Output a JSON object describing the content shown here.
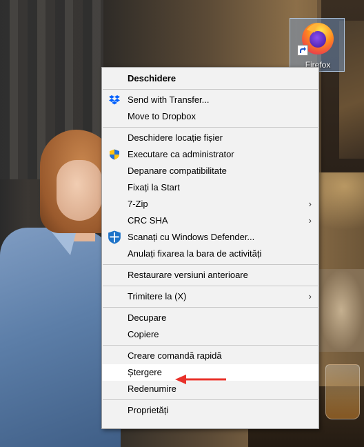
{
  "desktop": {
    "icon_label": "Firefox",
    "icon_name": "firefox-icon"
  },
  "menu": {
    "items": [
      {
        "label": "Deschidere"
      },
      {
        "label": "Send with Transfer...",
        "icon": "dropbox-icon"
      },
      {
        "label": "Move to Dropbox"
      },
      {
        "label": "Deschidere locație fișier"
      },
      {
        "label": "Executare ca administrator",
        "icon": "uac-shield-icon"
      },
      {
        "label": "Depanare compatibilitate"
      },
      {
        "label": "Fixați la Start"
      },
      {
        "label": "7-Zip",
        "submenu": true
      },
      {
        "label": "CRC SHA",
        "submenu": true
      },
      {
        "label": "Scanați cu Windows Defender...",
        "icon": "windows-defender-icon"
      },
      {
        "label": "Anulați fixarea la bara de activități"
      },
      {
        "label": "Restaurare versiuni anterioare"
      },
      {
        "label": "Trimitere la (X)",
        "submenu": true
      },
      {
        "label": "Decupare"
      },
      {
        "label": "Copiere"
      },
      {
        "label": "Creare comandă rapidă"
      },
      {
        "label": "Ștergere"
      },
      {
        "label": "Redenumire"
      },
      {
        "label": "Proprietăți"
      }
    ],
    "submenu_glyph": "›"
  },
  "colors": {
    "annotation_arrow": "#e8312a",
    "menu_background": "#f2f2f2",
    "dropbox_blue": "#0061fe",
    "defender_blue": "#1e73c8"
  }
}
